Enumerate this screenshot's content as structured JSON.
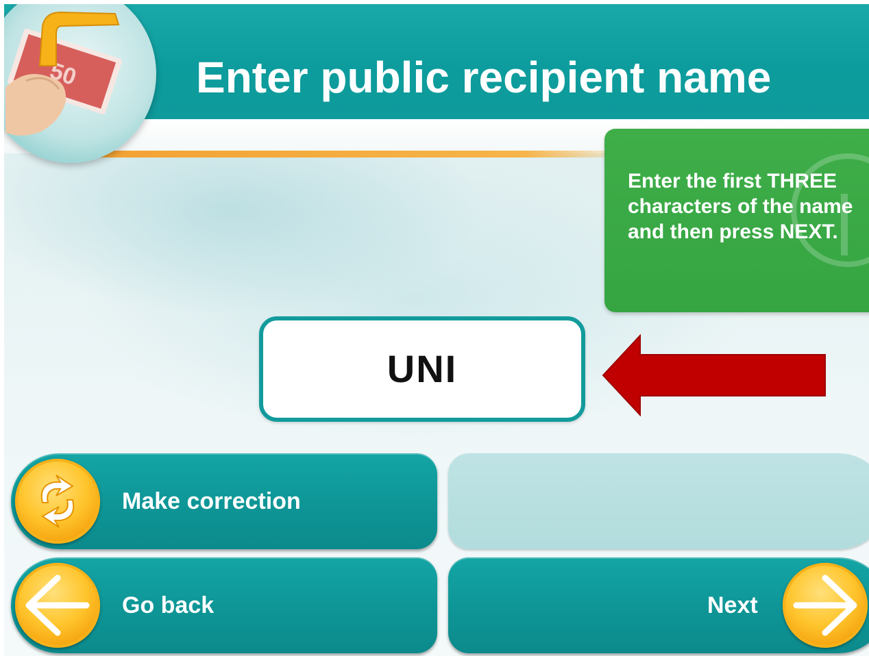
{
  "header": {
    "title": "Enter public recipient name"
  },
  "hint": {
    "text": "Enter the first THREE characters of the name and then press NEXT."
  },
  "input": {
    "value": "UNI"
  },
  "buttons": {
    "make_correction": "Make correction",
    "go_back": "Go back",
    "next": "Next"
  },
  "icons": {
    "logo": "banknote-hand-icon",
    "correction": "swap-arrows-icon",
    "back": "arrow-left-icon",
    "next": "arrow-right-icon",
    "pointer": "red-arrow-left-icon"
  },
  "colors": {
    "teal": "#0f9a9b",
    "green_hint": "#3aaa46",
    "orange_icon": "#f7a91a",
    "red_arrow": "#c00000"
  }
}
